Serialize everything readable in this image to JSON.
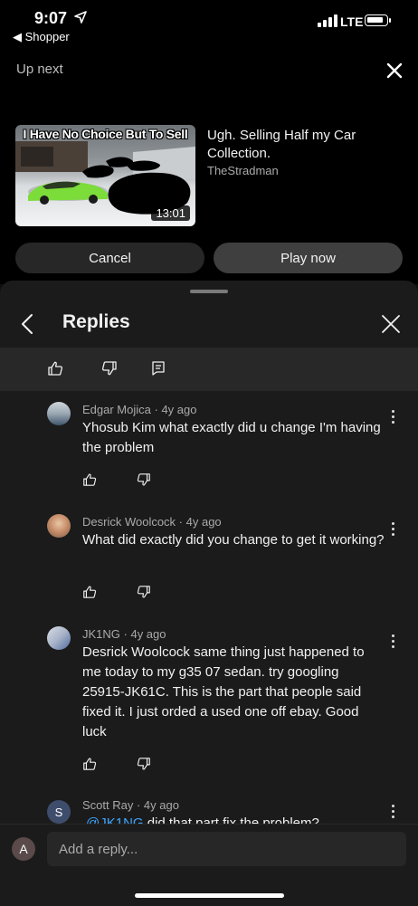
{
  "status_bar": {
    "time": "9:07",
    "back_app": "◀ Shopper",
    "network": "LTE"
  },
  "up_next": {
    "label": "Up next",
    "thumbnail_title": "I Have No Choice But To Sell",
    "duration": "13:01",
    "video_title": "Ugh. Selling Half my Car Collection.",
    "channel": "TheStradman",
    "cancel_label": "Cancel",
    "play_label": "Play now"
  },
  "replies": {
    "title": "Replies",
    "comments": [
      {
        "author": "Edgar Mojica",
        "age": "4y ago",
        "text": "Yhosub Kim what exactly did u change I'm having the problem"
      },
      {
        "author": "Desrick Woolcock",
        "age": "4y ago",
        "text": "What did exactly did you change to get it working?"
      },
      {
        "author": "JK1NG",
        "age": "4y ago",
        "text": "Desrick Woolcock same thing just happened to me today to my g35 07 sedan. try googling 25915-JK61C. This is the part that people said fixed it. I just orded a used one off ebay. Good luck"
      },
      {
        "author": "Scott Ray",
        "age": "4y ago",
        "avatar_letter": "S",
        "mention": "@JK1NG",
        "text": "did that part fix the problem?"
      }
    ]
  },
  "footer": {
    "avatar_letter": "A",
    "placeholder": "Add a reply..."
  },
  "colors": {
    "background": "#0f0f0f",
    "sheet": "#1b1b1b",
    "link": "#3ea6ff"
  },
  "icons": [
    "location-arrow-icon",
    "signal-icon",
    "battery-icon",
    "close-icon",
    "back-chevron-icon",
    "thumbs-up-icon",
    "thumbs-down-icon",
    "reply-icon",
    "more-vertical-icon"
  ]
}
